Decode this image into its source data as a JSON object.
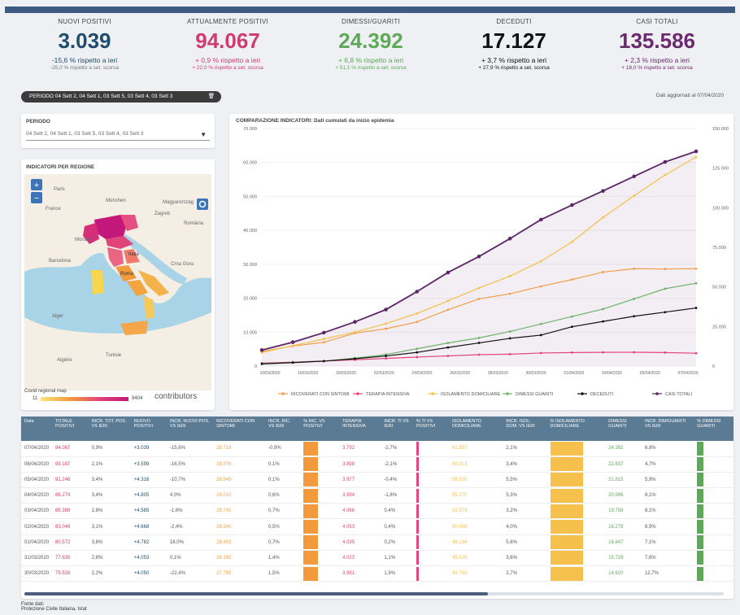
{
  "kpis": [
    {
      "label": "NUOVI POSITIVI",
      "value": "3.039",
      "delta": "-15,6 % rispetto a ieri",
      "sub": "-25,0 % rispetto a set. scorsa",
      "color": "#1f4d6b",
      "dcolor": "#1f4d6b"
    },
    {
      "label": "ATTUALMENTE POSITIVI",
      "value": "94.067",
      "delta": "+ 0,9 % rispetto a ieri",
      "sub": "+ 22,0 % rispetto a set. scorsa",
      "color": "#d13c6f",
      "dcolor": "#d13c6f"
    },
    {
      "label": "DIMESSI/GUARITI",
      "value": "24.392",
      "delta": "+ 6,8 % rispetto a ieri",
      "sub": "+ 51,1 % rispetto a set. scorsa",
      "color": "#5fa85a",
      "dcolor": "#5fa85a"
    },
    {
      "label": "DECEDUTI",
      "value": "17.127",
      "delta": "+ 3,7 % rispetto a ieri",
      "sub": "+ 27,9 % rispetto a set. scorsa",
      "color": "#111111",
      "dcolor": "#111111"
    },
    {
      "label": "CASI TOTALI",
      "value": "135.586",
      "delta": "+ 2,3 % rispetto a ieri",
      "sub": "+ 18,0 % rispetto a set. scorsa",
      "color": "#6b2a6e",
      "dcolor": "#6b2a6e"
    }
  ],
  "filter": {
    "pill": "PERIODO 04 Sett 2, 04 Sett 1, 03 Sett 5, 03 Sett 4, 03 Sett 3",
    "trash": "🗑",
    "updated": "Dati aggiornati al 07/04/2020"
  },
  "period": {
    "title": "PERIODO",
    "value": "04 Sett 2, 04 Sett 1, 03 Sett 5, 03 Sett 4, 03 Sett 3",
    "arrow": "▼"
  },
  "map": {
    "title": "INDICATORI PER REGIONE",
    "legend_title": "Covid regional map",
    "legend_min": "11",
    "legend_max": "9404",
    "credit": "contributors",
    "labels": [
      "Paris",
      "France",
      "München",
      "Zagreb",
      "Magyarország",
      "România",
      "Barcelona",
      "Roma",
      "Italia",
      "Crna Gora",
      "Tunisie",
      "Alger",
      "Algérie",
      "Monaco"
    ],
    "zoom_in": "+",
    "zoom_out": "−"
  },
  "chart_data": {
    "type": "line",
    "title": "COMPARAZIONE INDICATORI: Dati cumulati da inizio epidemia",
    "x": [
      "10/03/2020",
      "12/03/2020",
      "14/03/2020",
      "16/03/2020",
      "18/03/2020",
      "20/03/2020",
      "22/03/2020",
      "24/03/2020",
      "26/03/2020",
      "28/03/2020",
      "30/03/2020",
      "01/04/2020",
      "03/04/2020",
      "05/04/2020",
      "07/04/2020"
    ],
    "x_ticks": [
      "10/03/2020",
      "16/03/2020",
      "20/03/2020",
      "22/03/2020",
      "24/03/2020",
      "26/03/2020",
      "28/03/2020",
      "30/03/2020",
      "01/04/2020",
      "03/04/2020",
      "05/04/2020",
      "07/04/2020"
    ],
    "ylim_left": [
      0,
      70000
    ],
    "yticks_left": [
      "70.000",
      "60.000",
      "50.000",
      "40.000",
      "30.000",
      "20.000",
      "10.000",
      "0"
    ],
    "ylim_right": [
      0,
      150000
    ],
    "yticks_right": [
      "150.000",
      "125.000",
      "100.000",
      "75.000",
      "50.000",
      "25.000",
      "0"
    ],
    "series": [
      {
        "name": "RICOVERATI CON SINTOMI",
        "color": "#f0a04b",
        "axis": "left",
        "values": [
          4300,
          5900,
          7000,
          9700,
          11000,
          13000,
          16600,
          19800,
          21300,
          23500,
          25500,
          27700,
          28700,
          28600,
          28700
        ]
      },
      {
        "name": "TERAPIA INTENSIVA",
        "color": "#e5457a",
        "axis": "left",
        "values": [
          880,
          1150,
          1500,
          1850,
          2250,
          2650,
          3000,
          3350,
          3500,
          3850,
          3980,
          4050,
          4070,
          3980,
          3790
        ]
      },
      {
        "name": "ISOLAMENTO DOMICILIARE",
        "color": "#f5c04b",
        "axis": "left",
        "values": [
          4000,
          6000,
          8000,
          10000,
          12500,
          15500,
          19200,
          23000,
          26500,
          30900,
          36600,
          43800,
          50200,
          56300,
          61600
        ]
      },
      {
        "name": "DIMESSI GUARITI",
        "color": "#6db36a",
        "axis": "left",
        "values": [
          720,
          1050,
          1450,
          2350,
          3400,
          5100,
          6800,
          8300,
          10200,
          12400,
          14600,
          16800,
          19800,
          22800,
          24400
        ]
      },
      {
        "name": "DECEDUTI",
        "color": "#111111",
        "axis": "left",
        "values": [
          630,
          1020,
          1450,
          2160,
          2980,
          4030,
          5480,
          6820,
          8160,
          9130,
          11590,
          13150,
          14680,
          15890,
          17130
        ]
      },
      {
        "name": "CASI TOTALI",
        "color": "#5b2766",
        "axis": "right",
        "values": [
          10100,
          15100,
          21100,
          27900,
          35700,
          47000,
          59100,
          69200,
          80500,
          92500,
          101700,
          110600,
          119800,
          128900,
          135600
        ]
      }
    ]
  },
  "table": {
    "headers": [
      "Data",
      "TOTALE POSITIVI",
      "INCR. TOT. POS. VS IERI",
      "NUOVO POSITIVI",
      "INCR. NUOVI POS. VS IERI",
      "RICOVERATI CON SINTOMI",
      "INCR. RIC. VS IERI",
      "% RIC. VS POSITIVI",
      "TERAPIA INTENSIVA",
      "INCR. TI VS IERI",
      "% TI VS POSITIVI",
      "ISOLAMENTO DOMICILIARE",
      "INCR. ISOL. DOM. VS IERI",
      "% ISOLAMENTO DOMICILIARE",
      "DIMESSI GUARITI",
      "INCR. DIM/GUARITI VS IERI",
      "% DIMESSI GUARITI"
    ],
    "rows": [
      [
        "07/04/2020",
        "94.067",
        "0,9%",
        "+3.039",
        "-15,6%",
        "28.718",
        "-0,9%",
        "",
        "3.792",
        "-2,7%",
        "",
        "61.557",
        "2,1%",
        "",
        "24.392",
        "6,8%",
        ""
      ],
      [
        "06/04/2020",
        "93.187",
        "2,1%",
        "+3.599",
        "-16,5%",
        "28.976",
        "0,1%",
        "",
        "3.898",
        "-2,1%",
        "",
        "60.313",
        "3,4%",
        "",
        "22.837",
        "4,7%",
        ""
      ],
      [
        "05/04/2020",
        "91.246",
        "3,4%",
        "+4.316",
        "-10,7%",
        "28.949",
        "0,1%",
        "",
        "3.977",
        "-0,4%",
        "",
        "58.320",
        "5,5%",
        "",
        "21.815",
        "5,9%",
        ""
      ],
      [
        "04/04/2020",
        "88.274",
        "3,4%",
        "+4.805",
        "4,0%",
        "29.010",
        "0,6%",
        "",
        "3.994",
        "-1,8%",
        "",
        "55.270",
        "5,3%",
        "",
        "20.996",
        "8,1%",
        ""
      ],
      [
        "03/04/2020",
        "85.388",
        "2,8%",
        "+4.585",
        "-1,6%",
        "28.741",
        "0,7%",
        "",
        "4.068",
        "0,4%",
        "",
        "52.579",
        "3,2%",
        "",
        "19.758",
        "8,1%",
        ""
      ],
      [
        "02/04/2020",
        "83.049",
        "3,1%",
        "+4.668",
        "-2,4%",
        "28.540",
        "0,5%",
        "",
        "4.053",
        "0,4%",
        "",
        "50.456",
        "4,0%",
        "",
        "18.278",
        "8,5%",
        ""
      ],
      [
        "01/04/2020",
        "80.572",
        "3,8%",
        "+4.782",
        "18,0%",
        "28.403",
        "0,7%",
        "",
        "4.035",
        "0,2%",
        "",
        "48.134",
        "5,6%",
        "",
        "16.847",
        "7,1%",
        ""
      ],
      [
        "31/03/2020",
        "77.635",
        "2,8%",
        "+4.053",
        "0,1%",
        "28.192",
        "1,4%",
        "",
        "4.023",
        "1,1%",
        "",
        "45.420",
        "3,6%",
        "",
        "15.729",
        "7,6%",
        ""
      ],
      [
        "30/03/2020",
        "75.528",
        "2,2%",
        "+4.050",
        "-22,4%",
        "27.795",
        "1,5%",
        "",
        "3.981",
        "1,9%",
        "",
        "43.752",
        "2,7%",
        "",
        "14.620",
        "12,7%",
        ""
      ]
    ]
  },
  "source": {
    "line1": "Fonte dati:",
    "line2": "Protezione Civile Italiana, Istat"
  }
}
